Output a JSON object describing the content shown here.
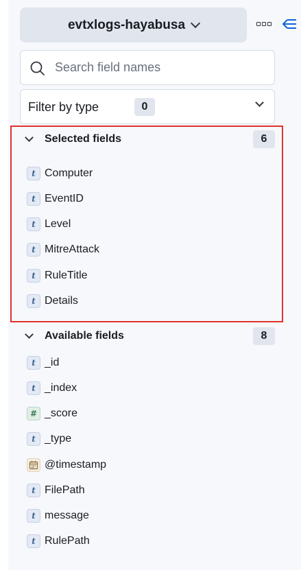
{
  "dataview": {
    "name": "evtxlogs-hayabusa"
  },
  "search": {
    "placeholder": "Search field names",
    "value": ""
  },
  "filter": {
    "label": "Filter by type",
    "count": "0"
  },
  "selected_fields": {
    "title": "Selected fields",
    "count": "6",
    "items": [
      {
        "name": "Computer",
        "type": "string",
        "token": "t"
      },
      {
        "name": "EventID",
        "type": "string",
        "token": "t"
      },
      {
        "name": "Level",
        "type": "string",
        "token": "t"
      },
      {
        "name": "MitreAttack",
        "type": "string",
        "token": "t"
      },
      {
        "name": "RuleTitle",
        "type": "string",
        "token": "t"
      },
      {
        "name": "Details",
        "type": "string",
        "token": "t"
      }
    ]
  },
  "available_fields": {
    "title": "Available fields",
    "count": "8",
    "items": [
      {
        "name": "_id",
        "type": "string",
        "token": "t"
      },
      {
        "name": "_index",
        "type": "string",
        "token": "t"
      },
      {
        "name": "_score",
        "type": "number",
        "token": "#"
      },
      {
        "name": "_type",
        "type": "string",
        "token": "t"
      },
      {
        "name": "@timestamp",
        "type": "date",
        "token": "calendar-icon"
      },
      {
        "name": "FilePath",
        "type": "string",
        "token": "t"
      },
      {
        "name": "message",
        "type": "string",
        "token": "t"
      },
      {
        "name": "RulePath",
        "type": "string",
        "token": "t"
      }
    ]
  },
  "colors": {
    "highlight": "#e0322d",
    "accent": "#0b64dd",
    "panel": "#f7f8fc"
  }
}
